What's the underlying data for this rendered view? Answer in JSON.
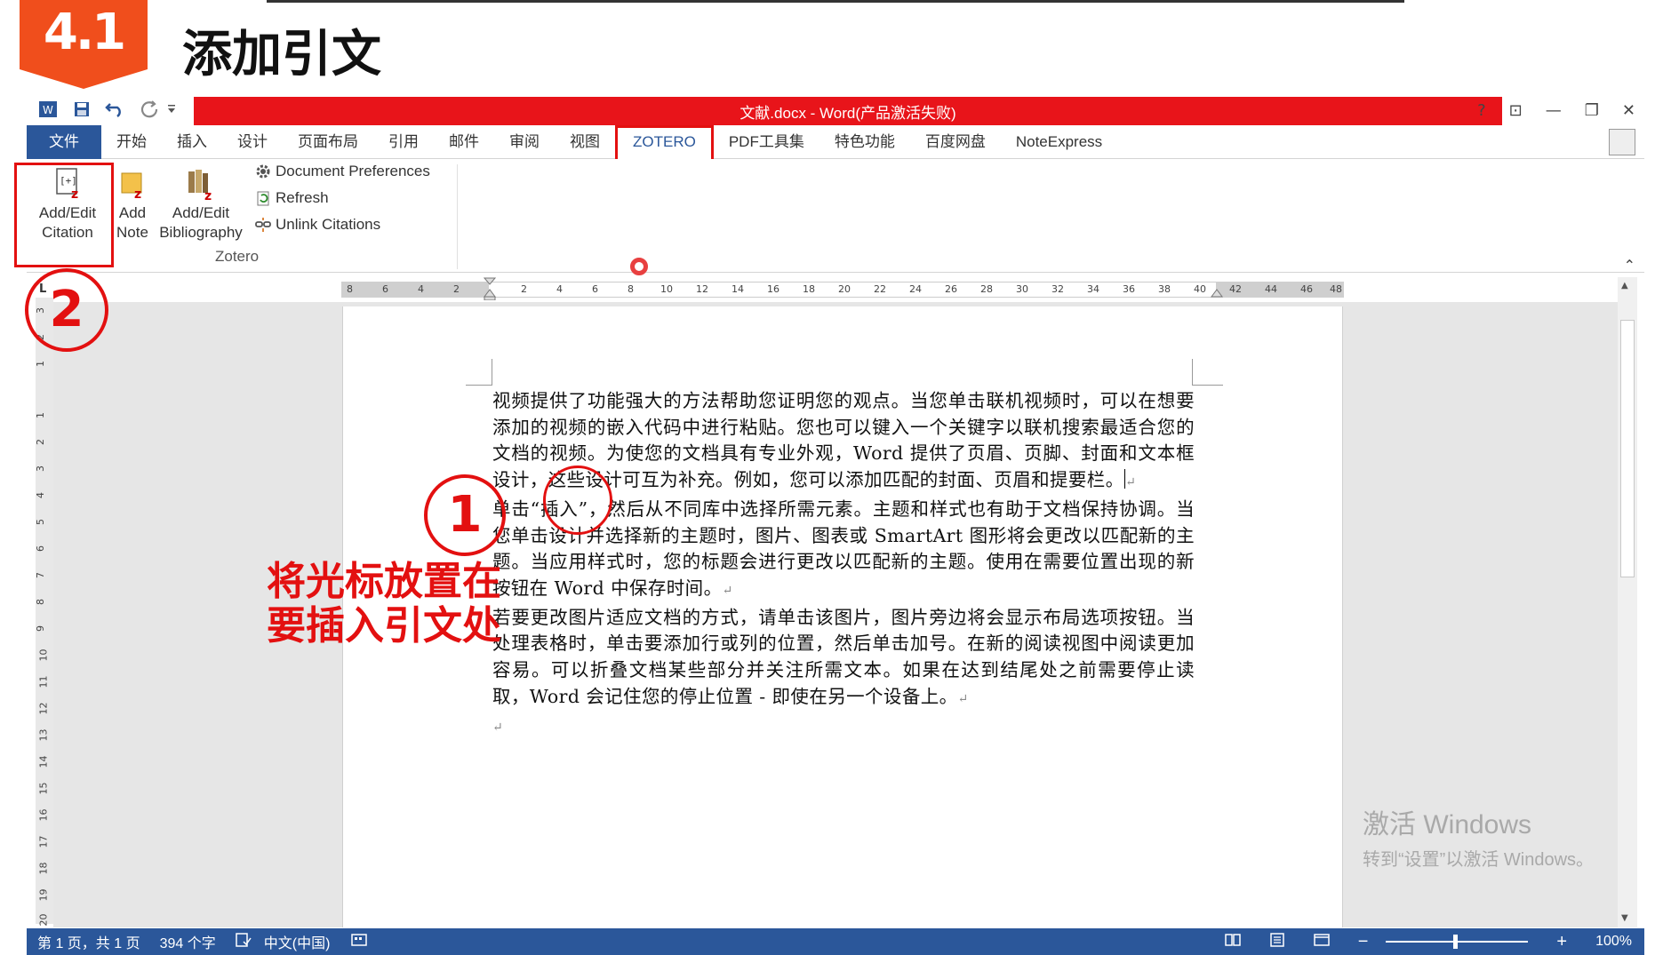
{
  "slide": {
    "badge": "4.1",
    "title": "添加引文"
  },
  "window": {
    "title": "文献.docx - Word(产品激活失败)",
    "controls": {
      "help": "?",
      "restore_ribbon": "⊡",
      "minimize": "—",
      "maximize": "❐",
      "close": "✕"
    }
  },
  "ribbon_tabs": [
    {
      "label": "文件"
    },
    {
      "label": "开始"
    },
    {
      "label": "插入"
    },
    {
      "label": "设计"
    },
    {
      "label": "页面布局"
    },
    {
      "label": "引用"
    },
    {
      "label": "邮件"
    },
    {
      "label": "审阅"
    },
    {
      "label": "视图"
    },
    {
      "label": "ZOTERO"
    },
    {
      "label": "PDF工具集"
    },
    {
      "label": "特色功能"
    },
    {
      "label": "百度网盘"
    },
    {
      "label": "NoteExpress"
    }
  ],
  "zotero_group": {
    "label": "Zotero",
    "add_edit_citation": "Add/Edit\nCitation",
    "add_note": "Add\nNote",
    "add_edit_bibliography": "Add/Edit\nBibliography",
    "document_preferences": "Document Preferences",
    "refresh": "Refresh",
    "unlink_citations": "Unlink Citations"
  },
  "ruler": {
    "corner": "L",
    "left_labels": [
      "8",
      "6",
      "4",
      "2"
    ],
    "right_labels": [
      "2",
      "4",
      "6",
      "8",
      "10",
      "12",
      "14",
      "16",
      "18",
      "20",
      "22",
      "24",
      "26",
      "28",
      "30",
      "32",
      "34",
      "36",
      "38",
      "40",
      "42",
      "44",
      "46",
      "48"
    ],
    "vertical_labels": [
      "3",
      "2",
      "1",
      "1",
      "2",
      "3",
      "4",
      "5",
      "6",
      "7",
      "8",
      "9",
      "10",
      "11",
      "12",
      "13",
      "14",
      "15",
      "16",
      "17",
      "18",
      "19",
      "20"
    ]
  },
  "document": {
    "para1_a": "视频提供了功能强大的方法帮助您证明您的观点。当您单击联机视频时，可以在想要添加的视频的嵌入代码中进行粘贴。您也可以键入一个关键字以联机搜索最适合您的文档的视频。为使您的文档具有专业外观，Word 提供了页眉、页脚、封面和文本框设计，这些设计可互为补充。例如，您可以添加匹配的封面、页眉和提要栏。",
    "para2": "单击“插入”，然后从不同库中选择所需元素。主题和样式也有助于文档保持协调。当您单击设计并选择新的主题时，图片、图表或 SmartArt 图形将会更改以匹配新的主题。当应用样式时，您的标题会进行更改以匹配新的主题。使用在需要位置出现的新按钮在 Word 中保存时间。",
    "para3": "若要更改图片适应文档的方式，请单击该图片，图片旁边将会显示布局选项按钮。当处理表格时，单击要添加行或列的位置，然后单击加号。在新的阅读视图中阅读更加容易。可以折叠文档某些部分并关注所需文本。如果在达到结尾处之前需要停止读取，Word 会记住您的停止位置 - 即使在另一个设备上。",
    "para_mark": "↵"
  },
  "annotations": {
    "step1": "1",
    "step2": "2",
    "note_line1": "将光标放置在",
    "note_line2": "要插入引文处"
  },
  "statusbar": {
    "page": "第 1 页，共 1 页",
    "words": "394 个字",
    "language": "中文(中国)",
    "zoom_minus": "−",
    "zoom_plus": "+",
    "zoom": "100%"
  },
  "watermark": {
    "line1": "激活 Windows",
    "line2": "转到“设置”以激活 Windows。"
  },
  "colors": {
    "accent": "#2b579a",
    "title_strip": "#e8141a",
    "annotation": "#e31010",
    "badge": "#f04e1c"
  }
}
